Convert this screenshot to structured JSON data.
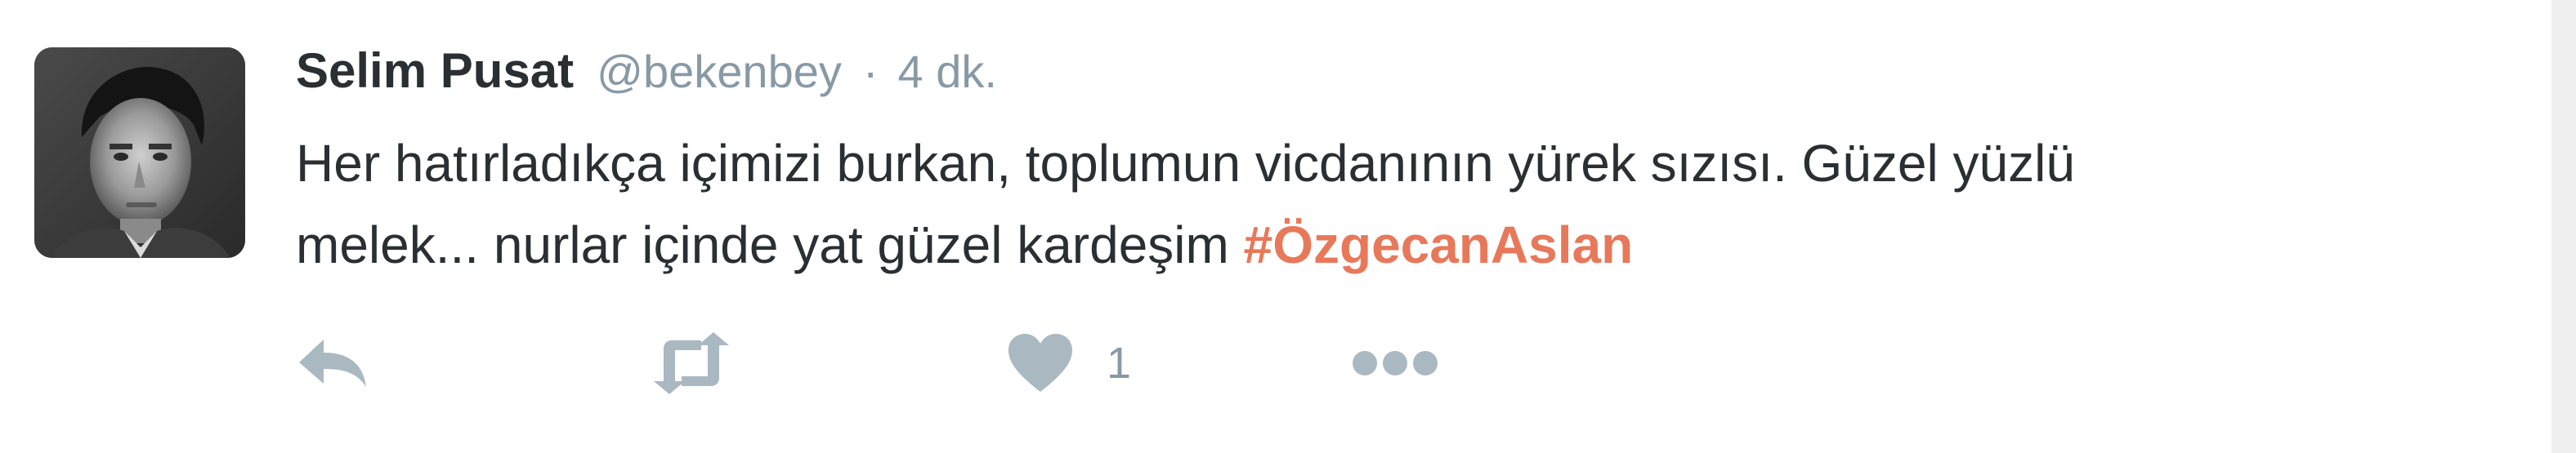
{
  "tweet": {
    "author_name": "Selim Pusat",
    "author_handle": "@bekenbey",
    "separator": "·",
    "time": "4 dk.",
    "text_line1": "Her hatırladıkça içimizi burkan, toplumun vicdanının yürek sızısı. Güzel yüzlü",
    "text_line2": "melek... nurlar içinde yat güzel kardeşim ",
    "hashtag": "#ÖzgecanAslan",
    "like_count": "1"
  },
  "actions": {
    "reply_icon": "reply-arrow-icon",
    "retweet_icon": "retweet-icon",
    "like_icon": "heart-icon",
    "more_icon": "ellipsis-icon"
  },
  "colors": {
    "hashtag": "#e8785a",
    "muted": "#8899a6",
    "icon": "#aab8c2",
    "text": "#292f33"
  }
}
